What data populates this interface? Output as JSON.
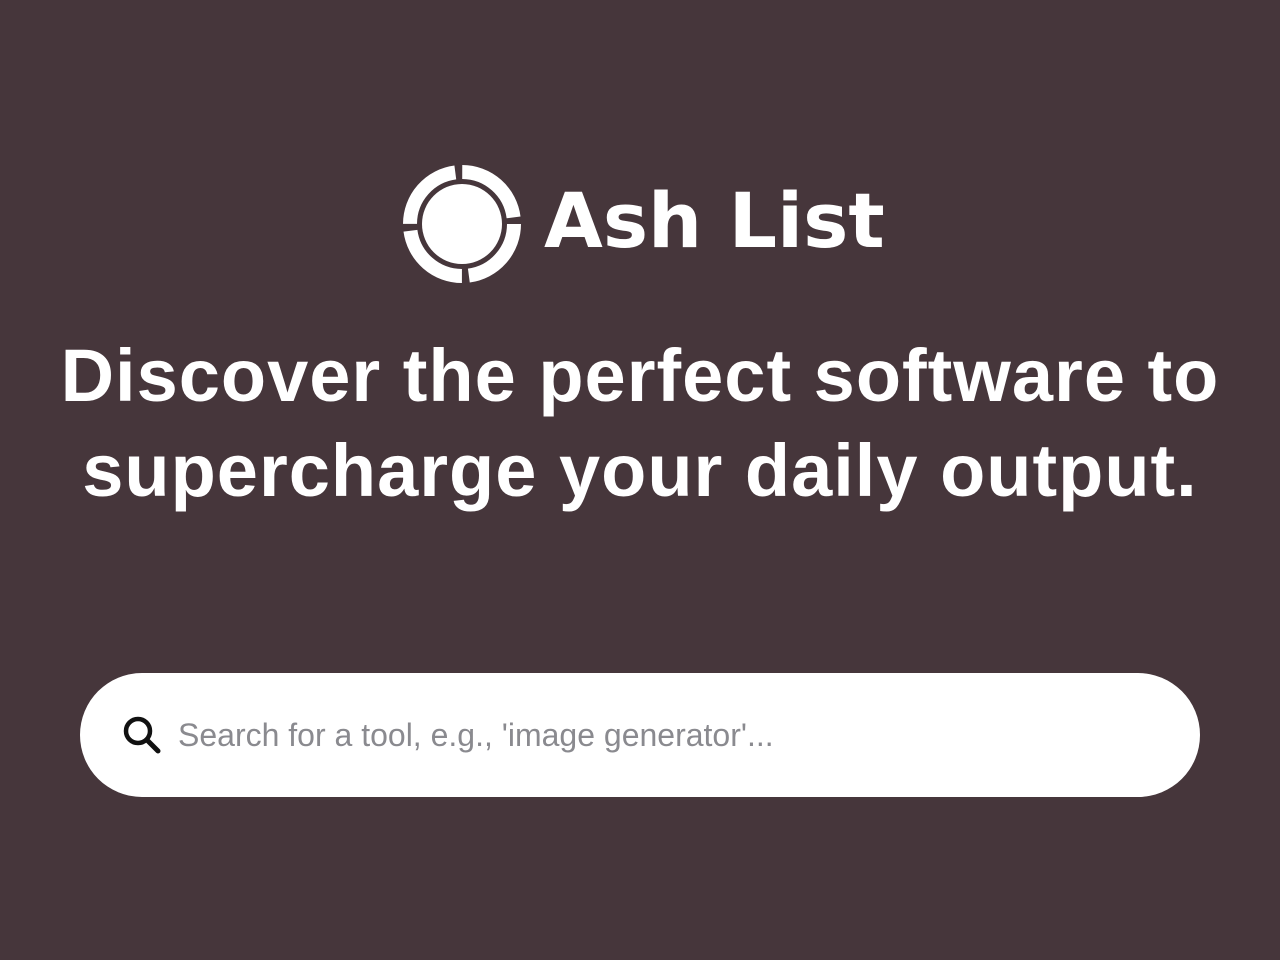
{
  "brand": {
    "name": "Ash List",
    "logo_icon": "target-ring-icon"
  },
  "hero": {
    "headline": "Discover the perfect software to supercharge your daily output."
  },
  "search": {
    "icon": "search-icon",
    "value": "",
    "placeholder": "Search for a tool, e.g., 'image generator'..."
  },
  "colors": {
    "background": "#46363b",
    "foreground": "#ffffff",
    "search_background": "#ffffff",
    "placeholder": "#8a8a8f"
  }
}
